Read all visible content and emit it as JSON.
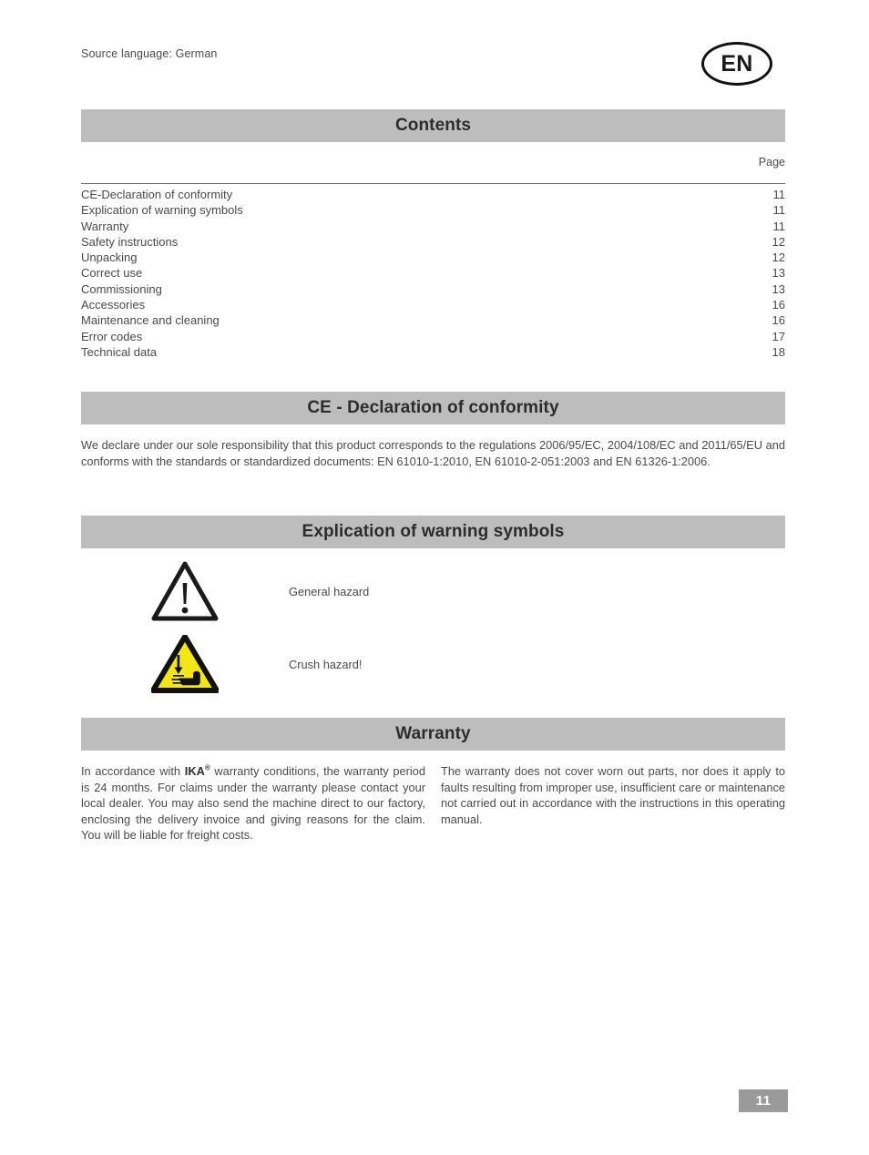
{
  "document": {
    "source_language_note": "Source language: German",
    "language_badge": "EN",
    "footer_page_number": "11"
  },
  "contents": {
    "heading": "Contents",
    "page_column_label": "Page",
    "entries": [
      {
        "label": "CE-Declaration of conformity",
        "page": "11"
      },
      {
        "label": "Explication of warning symbols",
        "page": "11"
      },
      {
        "label": "Warranty",
        "page": "11"
      },
      {
        "label": "Safety instructions",
        "page": "12"
      },
      {
        "label": "Unpacking",
        "page": "12"
      },
      {
        "label": "Correct use",
        "page": "13"
      },
      {
        "label": "Commissioning",
        "page": "13"
      },
      {
        "label": "Accessories",
        "page": "16"
      },
      {
        "label": "Maintenance and cleaning",
        "page": "16"
      },
      {
        "label": "Error codes",
        "page": "17"
      },
      {
        "label": "Technical data",
        "page": "18"
      }
    ]
  },
  "ce_declaration": {
    "heading": "CE - Declaration of conformity",
    "body": "We declare under our sole responsibility that this product corresponds to the regulations 2006/95/EC, 2004/108/EC and 2011/65/EU and conforms with the standards or standardized documents: EN 61010-1:2010, EN 61010-2-051:2003 and EN 61326-1:2006."
  },
  "warning_symbols": {
    "heading": "Explication of warning symbols",
    "items": [
      {
        "icon": "general-hazard-triangle-icon",
        "label": "General hazard"
      },
      {
        "icon": "crush-hazard-triangle-icon",
        "label": "Crush hazard!"
      }
    ]
  },
  "warranty": {
    "heading": "Warranty",
    "left_prefix": "In accordance with ",
    "left_brand": "IKA",
    "left_brand_mark": "®",
    "left_rest": " warranty conditions, the warranty period is 24 months. For claims under the warranty please contact your local dealer. You may also send the machine direct to our factory, enclosing the delivery invoice and giving reasons for the claim. You will be liable for freight costs.",
    "right": "The warranty does not cover worn out parts, nor does it apply to faults resulting from improper use, insufficient care or maintenance not carried out in accordance with the instructions in this operating manual."
  },
  "colors": {
    "header_bar_gray": "#bdbdbd",
    "footer_badge_gray": "#9a9a9a",
    "body_text": "#4a4a4a",
    "hazard_yellow": "#f2e616",
    "hazard_black": "#111111"
  }
}
